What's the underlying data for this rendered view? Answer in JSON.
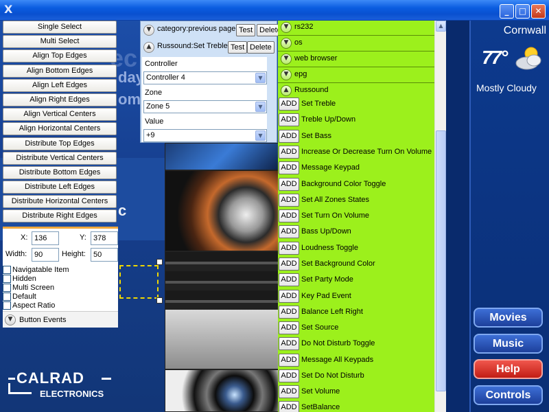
{
  "titlebar": {
    "app_icon": "X",
    "minimize": "_",
    "maximize": "□",
    "close": "✕"
  },
  "background": {
    "text1": "ec",
    "text2": "day",
    "text3": "om",
    "text4": "c"
  },
  "toolbox": {
    "buttons": [
      "Single Select",
      "Multi Select",
      "Align Top Edges",
      "Align Bottom Edges",
      "Align Left Edges",
      "Align Right Edges",
      "Align Vertical Centers",
      "Align Horizontal Centers",
      "Distribute Top Edges",
      "Distribute Vertical Centers",
      "Distribute Bottom Edges",
      "Distribute Left Edges",
      "Distribute Horizontal Centers",
      "Distribute Right Edges"
    ]
  },
  "props": {
    "x_label": "X:",
    "x_value": "136",
    "y_label": "Y:",
    "y_value": "378",
    "w_label": "Width:",
    "w_value": "90",
    "h_label": "Height:",
    "h_value": "50",
    "checks": [
      "Navigatable Item",
      "Hidden",
      "Multi Screen",
      "Default",
      "Aspect Ratio"
    ],
    "button_events": "Button Events"
  },
  "actions": {
    "row1_label": "category:previous page",
    "row2_label": "Russound:Set Treble",
    "test": "Test",
    "delete": "Delete",
    "controller_label": "Controller",
    "controller_value": "Controller 4",
    "zone_label": "Zone",
    "zone_value": "Zone 5",
    "value_label": "Value",
    "value_value": "+9"
  },
  "commands": {
    "categories": [
      "rs232",
      "os",
      "web browser",
      "epg",
      "Russound"
    ],
    "add_label": "ADD",
    "items": [
      "Set Treble",
      "Treble Up/Down",
      "Set Bass",
      "Increase Or Decrease Turn On Volume",
      "Message Keypad",
      "Background Color Toggle",
      "Set All Zones States",
      "Set Turn On Volume",
      "Bass Up/Down",
      "Loudness Toggle",
      "Set Background Color",
      "Set Party Mode",
      "Key Pad Event",
      "Balance Left Right",
      "Set Source",
      "Do Not Disturb Toggle",
      "Message All Keypads",
      "Set Do Not Disturb",
      "Set Volume",
      "SetBalance"
    ]
  },
  "weather": {
    "city": "Cornwall",
    "temp": "77°",
    "condition": "Mostly Cloudy"
  },
  "nav": {
    "movies": "Movies",
    "music": "Music",
    "help": "Help",
    "controls": "Controls"
  },
  "brand": {
    "line1": "CALRAD",
    "line2": "ELECTRONICS"
  }
}
